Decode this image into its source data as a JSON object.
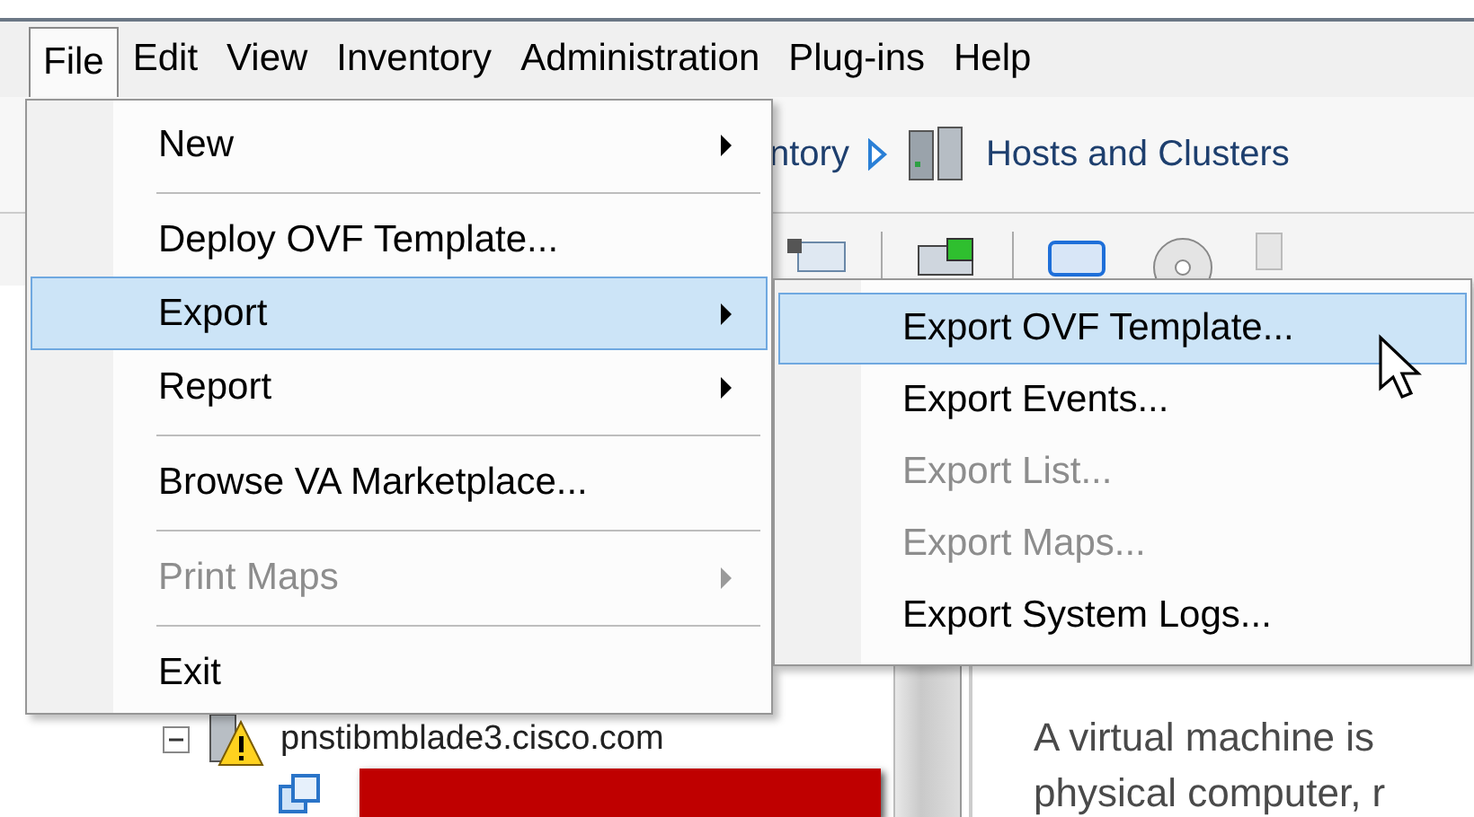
{
  "menubar": [
    {
      "label": "File",
      "selected": true
    },
    {
      "label": "Edit",
      "selected": false
    },
    {
      "label": "View",
      "selected": false
    },
    {
      "label": "Inventory",
      "selected": false
    },
    {
      "label": "Administration",
      "selected": false
    },
    {
      "label": "Plug-ins",
      "selected": false
    },
    {
      "label": "Help",
      "selected": false
    }
  ],
  "breadcrumb": [
    {
      "label": "ntory"
    },
    {
      "label": "Hosts and Clusters"
    }
  ],
  "tree": [
    {
      "label": "pnstibmblade3.cisco.com",
      "expanded": true,
      "warning": true,
      "children": [
        {
          "kind": "redacted"
        }
      ]
    }
  ],
  "description": [
    "A virtual machine is",
    "physical computer, r"
  ],
  "file_menu": [
    {
      "kind": "item",
      "label": "New",
      "submenu": true,
      "disabled": false,
      "selected": false
    },
    {
      "kind": "separator"
    },
    {
      "kind": "item",
      "label": "Deploy OVF Template...",
      "submenu": false,
      "disabled": false,
      "selected": false
    },
    {
      "kind": "item",
      "label": "Export",
      "submenu": true,
      "disabled": false,
      "selected": true
    },
    {
      "kind": "item",
      "label": "Report",
      "submenu": true,
      "disabled": false,
      "selected": false
    },
    {
      "kind": "separator"
    },
    {
      "kind": "item",
      "label": "Browse VA Marketplace...",
      "submenu": false,
      "disabled": false,
      "selected": false
    },
    {
      "kind": "separator"
    },
    {
      "kind": "item",
      "label": "Print Maps",
      "submenu": true,
      "disabled": true,
      "selected": false
    },
    {
      "kind": "separator"
    },
    {
      "kind": "item",
      "label": "Exit",
      "submenu": false,
      "disabled": false,
      "selected": false
    }
  ],
  "export_submenu": [
    {
      "kind": "item",
      "label": "Export OVF Template...",
      "submenu": false,
      "disabled": false,
      "selected": true
    },
    {
      "kind": "item",
      "label": "Export Events...",
      "submenu": false,
      "disabled": false,
      "selected": false
    },
    {
      "kind": "item",
      "label": "Export List...",
      "submenu": false,
      "disabled": true,
      "selected": false
    },
    {
      "kind": "item",
      "label": "Export Maps...",
      "submenu": false,
      "disabled": true,
      "selected": false
    },
    {
      "kind": "item",
      "label": "Export System Logs...",
      "submenu": false,
      "disabled": false,
      "selected": false
    }
  ]
}
